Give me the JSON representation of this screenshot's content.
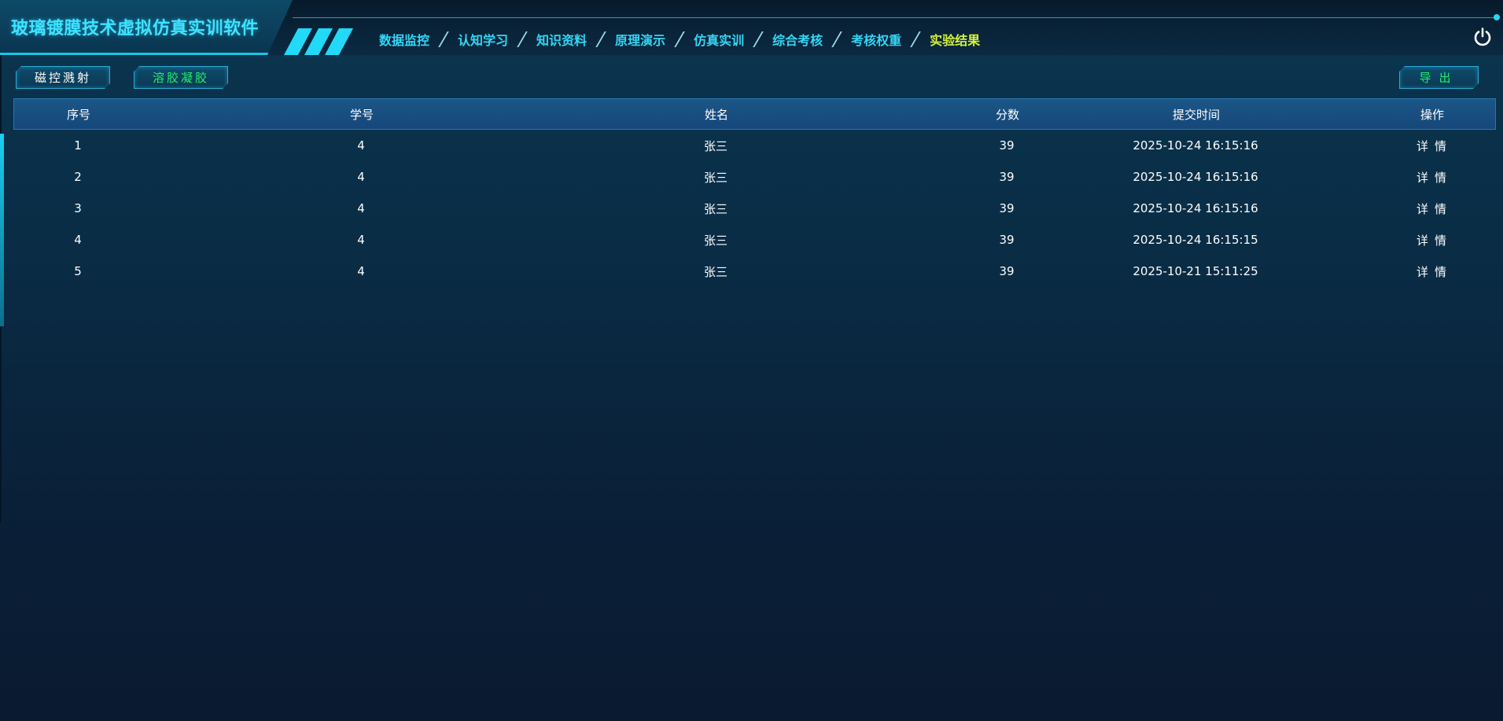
{
  "app": {
    "title": "玻璃镀膜技术虚拟仿真实训软件"
  },
  "nav": {
    "items": [
      {
        "label": "数据监控",
        "active": false
      },
      {
        "label": "认知学习",
        "active": false
      },
      {
        "label": "知识资料",
        "active": false
      },
      {
        "label": "原理演示",
        "active": false
      },
      {
        "label": "仿真实训",
        "active": false
      },
      {
        "label": "综合考核",
        "active": false
      },
      {
        "label": "考核权重",
        "active": false
      },
      {
        "label": "实验结果",
        "active": true
      }
    ],
    "power_icon": "power-icon"
  },
  "toolbar": {
    "magnetron_label": "磁控溅射",
    "solgel_label": "溶胶凝胶",
    "export_label": "导出"
  },
  "table": {
    "columns": [
      "序号",
      "学号",
      "姓名",
      "分数",
      "提交时间",
      "操作"
    ],
    "rows": [
      {
        "index": "1",
        "student_id": "4",
        "name": "张三",
        "score": "39",
        "submit_time": "2025-10-24 16:15:16",
        "action": "详情"
      },
      {
        "index": "2",
        "student_id": "4",
        "name": "张三",
        "score": "39",
        "submit_time": "2025-10-24 16:15:16",
        "action": "详情"
      },
      {
        "index": "3",
        "student_id": "4",
        "name": "张三",
        "score": "39",
        "submit_time": "2025-10-24 16:15:16",
        "action": "详情"
      },
      {
        "index": "4",
        "student_id": "4",
        "name": "张三",
        "score": "39",
        "submit_time": "2025-10-24 16:15:15",
        "action": "详情"
      },
      {
        "index": "5",
        "student_id": "4",
        "name": "张三",
        "score": "39",
        "submit_time": "2025-10-21 15:11:25",
        "action": "详情"
      }
    ]
  },
  "colors": {
    "accent_cyan": "#33d6f5",
    "active_nav": "#d4f23a",
    "green_button_text": "#1ff06c",
    "table_header_bg": "#1b5686"
  }
}
